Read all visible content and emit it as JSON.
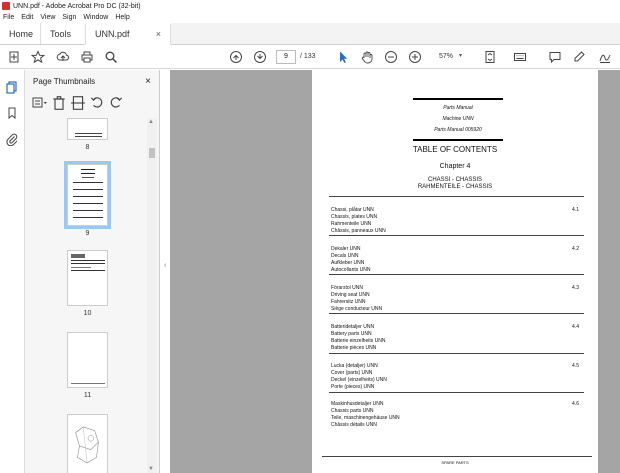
{
  "window": {
    "title": "UNN.pdf - Adobe Acrobat Pro DC (32-bit)"
  },
  "menu": [
    "File",
    "Edit",
    "View",
    "Sign",
    "Window",
    "Help"
  ],
  "tabs": {
    "home": "Home",
    "tools": "Tools",
    "doc": "UNN.pdf",
    "close": "×"
  },
  "toolbar": {
    "page_current": "9",
    "page_total": "/ 133",
    "zoom": "57%"
  },
  "thumbnails": {
    "title": "Page Thumbnails",
    "close": "×",
    "pages": [
      {
        "label": "8"
      },
      {
        "label": "9"
      },
      {
        "label": "10"
      },
      {
        "label": "11"
      }
    ]
  },
  "document": {
    "header": [
      "Parts Manual",
      "Machine UNN",
      "Parts Manual 005920"
    ],
    "toc_title": "TABLE OF CONTENTS",
    "chapter": "Chapter 4",
    "subtitle1": "CHASSI - CHASSIS",
    "subtitle2": "RAHMENTEILE - CHASSIS",
    "entries": [
      {
        "lines": [
          "Chassi, plåtar UNN",
          "Chassis, plates UNN",
          "Rahmenteile UNN",
          "Châssis, panneaux UNN"
        ],
        "num": "4.1"
      },
      {
        "lines": [
          "Dekaler UNN",
          "Decals UNN",
          "Aufkleber UNN",
          "Autocollants UNN"
        ],
        "num": "4.2"
      },
      {
        "lines": [
          "Förarstol UNN",
          "Driving seat UNN",
          "Fahrersitz UNN",
          "Siège conducteur UNN"
        ],
        "num": "4.3"
      },
      {
        "lines": [
          "Batteridetaljer UNN",
          "Battery parts UNN",
          "Batterie einzelheits UNN",
          "Batterie pièces UNN"
        ],
        "num": "4.4"
      },
      {
        "lines": [
          "Lucka (detaljer) UNN",
          "Cover (parts) UNN",
          "Deckel (einzelheits) UNN",
          "Porte (pieces) UNN"
        ],
        "num": "4.5"
      },
      {
        "lines": [
          "Maskinhusdetaljer UNN",
          "Chassis parts UNN",
          "Teile, maschinengehäuse UNN",
          "Châssis détails UNN"
        ],
        "num": "4.6"
      }
    ],
    "footer": "SPARE PARTS"
  },
  "colors": {
    "accent_blue": "#2d6fb8",
    "doc_bg": "#a5a5a5",
    "brand_red": "#d3302f"
  }
}
